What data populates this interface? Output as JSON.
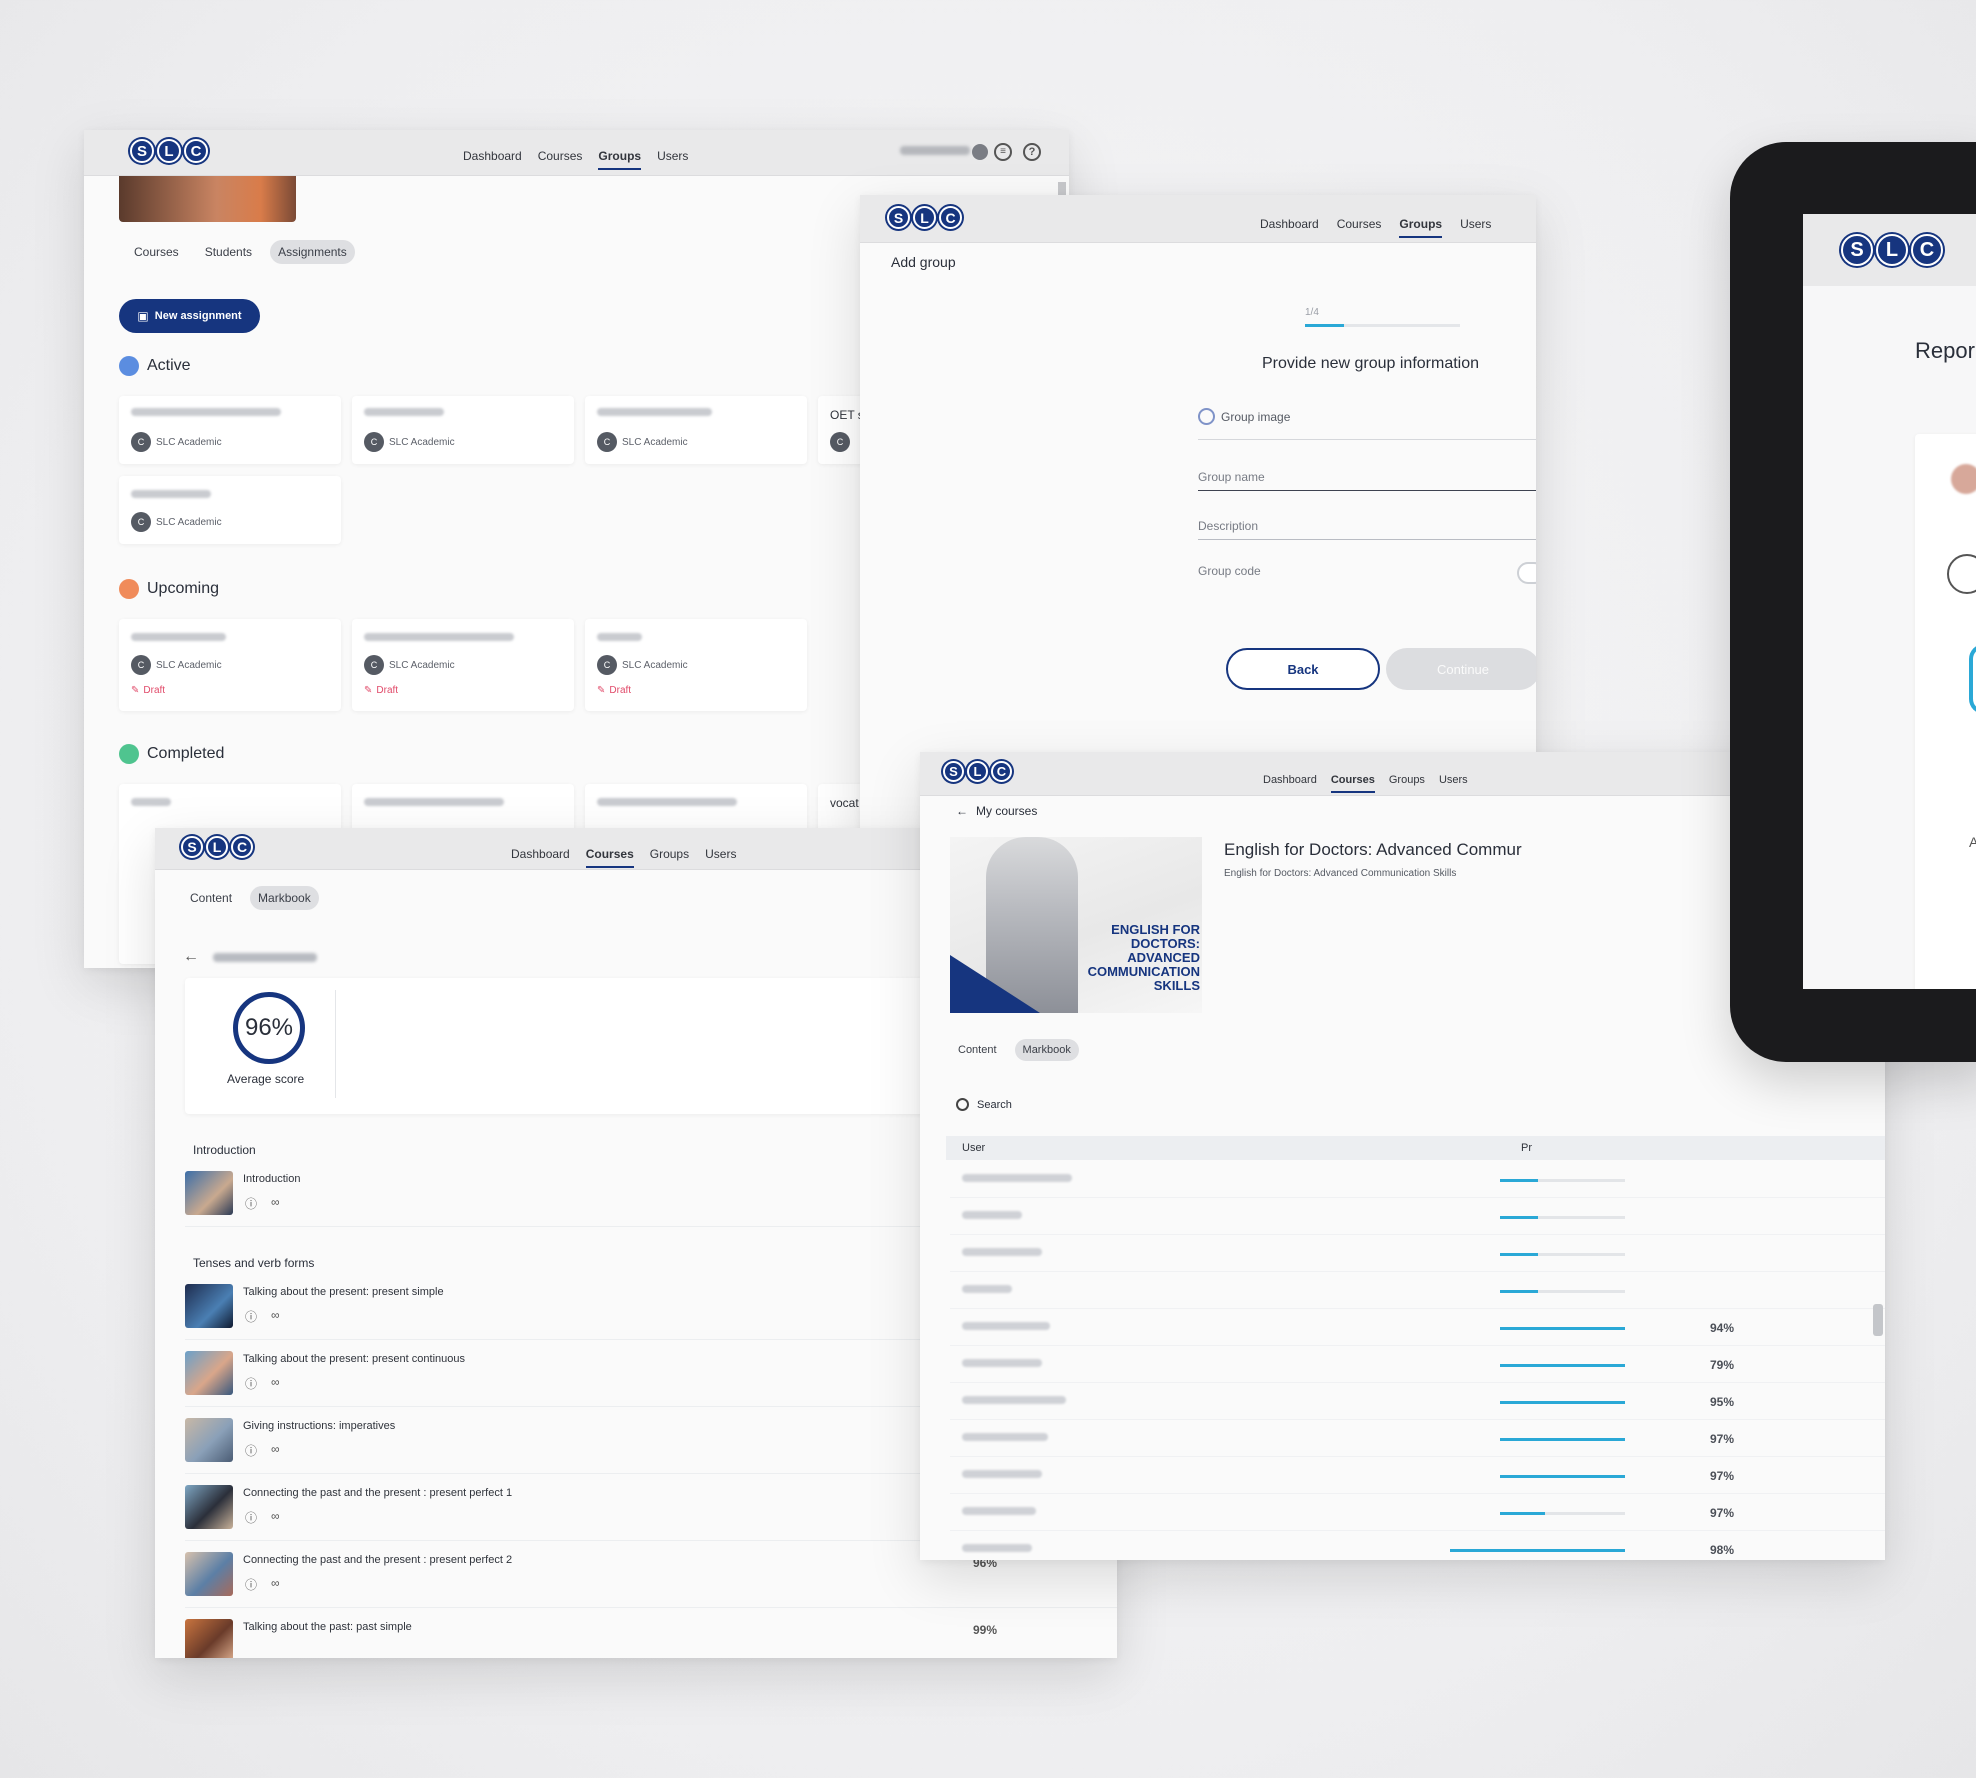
{
  "logo": {
    "letters": [
      "S",
      "L",
      "C"
    ]
  },
  "nav": {
    "dashboard": "Dashboard",
    "courses": "Courses",
    "groups": "Groups",
    "users": "Users"
  },
  "groups_window": {
    "tabs": {
      "courses": "Courses",
      "students": "Students",
      "assignments": "Assignments"
    },
    "new_assignment": "New assignment",
    "sections": {
      "active": "Active",
      "upcoming": "Upcoming",
      "completed": "Completed"
    },
    "author": "SLC Academic",
    "author_initial": "C",
    "draft_label": "Draft",
    "partial_label": "OET s",
    "partial_label_completed": "vocat"
  },
  "add_group": {
    "title": "Add group",
    "step": "1/4",
    "heading": "Provide new group information",
    "group_image": "Group image",
    "group_name": "Group name",
    "description": "Description",
    "group_code": "Group code",
    "back": "Back",
    "continue": "Continue"
  },
  "course_markbook": {
    "tabs": {
      "content": "Content",
      "markbook": "Markbook"
    },
    "average_score": "96%",
    "average_label": "Average score",
    "sections": [
      {
        "title": "Introduction",
        "lessons": [
          {
            "title": "Introduction",
            "score": ""
          }
        ]
      },
      {
        "title": "Tenses and verb forms",
        "lessons": [
          {
            "title": "Talking about the present: present simple",
            "score": ""
          },
          {
            "title": "Talking about the present: present continuous",
            "score": ""
          },
          {
            "title": "Giving instructions: imperatives",
            "score": ""
          },
          {
            "title": "Connecting the past and the present : present perfect 1",
            "score": ""
          },
          {
            "title": "Connecting the past and the present : present perfect 2",
            "score": "96%"
          },
          {
            "title": "Talking about the past: past simple",
            "score": "99%"
          }
        ]
      }
    ]
  },
  "course_detail": {
    "back_label": "My courses",
    "title": "English for Doctors: Advanced Commur",
    "subtitle": "English for Doctors: Advanced Communication Skills",
    "cover_text": "ENGLISH FOR DOCTORS: ADVANCED COMMUNICATION SKILLS",
    "tabs": {
      "content": "Content",
      "markbook": "Markbook"
    },
    "search": "Search",
    "col_user": "User",
    "col_progress": "Pr",
    "rows": [
      {
        "progress": 0.3,
        "pct": ""
      },
      {
        "progress": 0.3,
        "pct": ""
      },
      {
        "progress": 0.3,
        "pct": ""
      },
      {
        "progress": 0.3,
        "pct": ""
      },
      {
        "progress": 1.0,
        "pct": "94%"
      },
      {
        "progress": 1.0,
        "pct": "79%"
      },
      {
        "progress": 1.0,
        "pct": "95%"
      },
      {
        "progress": 1.0,
        "pct": "97%"
      },
      {
        "progress": 1.0,
        "pct": "97%"
      },
      {
        "progress": 0.36,
        "pct": "97%"
      },
      {
        "progress": 1.0,
        "pct": "98%"
      }
    ]
  },
  "tablet": {
    "partial_title": "Repor",
    "partial_letter": "A"
  },
  "colors": {
    "brand": "#16357f",
    "progress": "#2aa8d6",
    "draft": "#e14b6a"
  }
}
